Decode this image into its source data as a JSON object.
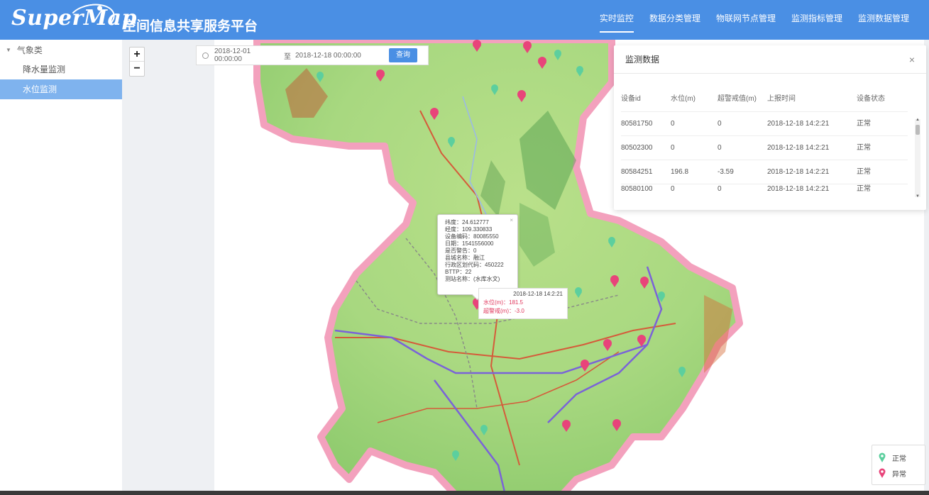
{
  "header": {
    "logo_text": "SuperMap",
    "title": "空间信息共享服务平台",
    "nav": [
      {
        "label": "实时监控",
        "active": true
      },
      {
        "label": "数据分类管理",
        "active": false
      },
      {
        "label": "物联网节点管理",
        "active": false
      },
      {
        "label": "监测指标管理",
        "active": false
      },
      {
        "label": "监测数据管理",
        "active": false
      }
    ]
  },
  "sidebar": {
    "group": "气象类",
    "items": [
      {
        "label": "降水量监测",
        "selected": false
      },
      {
        "label": "水位监测",
        "selected": true
      }
    ]
  },
  "map": {
    "zoom_in": "+",
    "zoom_out": "−",
    "filter": {
      "start": "2018-12-01 00:00:00",
      "separator": "至",
      "end": "2018-12-18 00:00:00",
      "query_label": "查询"
    },
    "popup": {
      "lines": [
        "纬度：24.612777",
        "经度：109.330833",
        "设备编码：80085550",
        "日期：1541556000",
        "是否警告：0",
        "县城名称：融江",
        "行政区划代码：450222",
        "BTTP：22",
        "测站名称：(水库水文)"
      ],
      "close": "×"
    },
    "label": {
      "time": "2018-12-18 14:2:21",
      "line1": "水位(m)：181.5",
      "line2": "超警戒(m)：-3.0"
    }
  },
  "panel": {
    "title": "监测数据",
    "close": "×",
    "columns": [
      "设备id",
      "水位(m)",
      "超警戒值(m)",
      "上报时间",
      "设备状态"
    ],
    "rows": [
      [
        "80581750",
        "0",
        "0",
        "2018-12-18 14:2:21",
        "正常"
      ],
      [
        "80502300",
        "0",
        "0",
        "2018-12-18 14:2:21",
        "正常"
      ],
      [
        "80584251",
        "196.8",
        "-3.59",
        "2018-12-18 14:2:21",
        "正常"
      ],
      [
        "80580100",
        "0",
        "0",
        "2018-12-18 14:2:21",
        "正常"
      ]
    ]
  },
  "legend": {
    "items": [
      {
        "label": "正常",
        "color": "#5ccf9e"
      },
      {
        "label": "异常",
        "color": "#e8447a"
      }
    ]
  },
  "colors": {
    "brand": "#4a8fe4",
    "selected": "#7fb3ee",
    "normal_pin": "#5ccf9e",
    "alarm_pin": "#e8447a"
  }
}
